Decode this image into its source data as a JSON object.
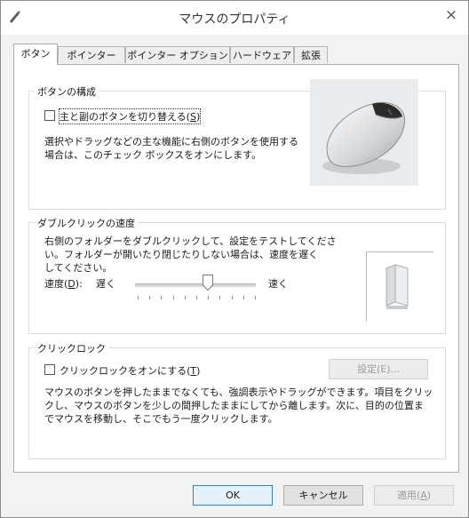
{
  "window": {
    "title": "マウスのプロパティ",
    "close_label": "×"
  },
  "tabs": [
    {
      "label": "ボタン",
      "active": true
    },
    {
      "label": "ポインター",
      "active": false
    },
    {
      "label": "ポインター オプション",
      "active": false
    },
    {
      "label": "ハードウェア",
      "active": false
    },
    {
      "label": "拡張",
      "active": false
    }
  ],
  "button_config": {
    "title": "ボタンの構成",
    "checkbox": {
      "label_main": "主と副のボタンを切り替える(",
      "accel": "S",
      "label_end": ")",
      "checked": false
    },
    "description_line1": "選択やドラッグなどの主な機能に右側のボタンを使用する",
    "description_line2": "場合は、このチェック ボックスをオンにします。",
    "image_icon": "mouse-icon"
  },
  "double_click": {
    "title": "ダブルクリックの速度",
    "description_line1": "右側のフォルダーをダブルクリックして、設定をテストしてくださ",
    "description_line2": "い。フォルダーが開いたり閉じたりしない場合は、速度を遅く",
    "description_line3": "してください。",
    "speed_label_main": "速度(",
    "speed_accel": "D",
    "speed_label_end": "):",
    "slow_label": "遅く",
    "fast_label": "速く",
    "speed_value": 0.6,
    "test_icon": "folder-icon"
  },
  "click_lock": {
    "title": "クリックロック",
    "checkbox": {
      "label_main": "クリックロックをオンにする(",
      "accel": "T",
      "label_end": ")",
      "checked": false
    },
    "settings_button": "設定(E)...",
    "description_line1": "マウスのボタンを押したままでなくても、強調表示やドラッグができます。項目をクリッ",
    "description_line2": "クし、マウスのボタンを少しの間押したままにしてから離します。次に、目的の位置ま",
    "description_line3": "でマウスを移動し、そこでもう一度クリックします。"
  },
  "footer": {
    "ok": "OK",
    "cancel": "キャンセル",
    "apply_main": "適用(",
    "apply_accel": "A",
    "apply_end": ")"
  },
  "colors": {
    "window_bg": "#f2f2f2",
    "panel_bg": "#ffffff",
    "border": "#adadad",
    "disabled_text": "#9a9a9a"
  }
}
